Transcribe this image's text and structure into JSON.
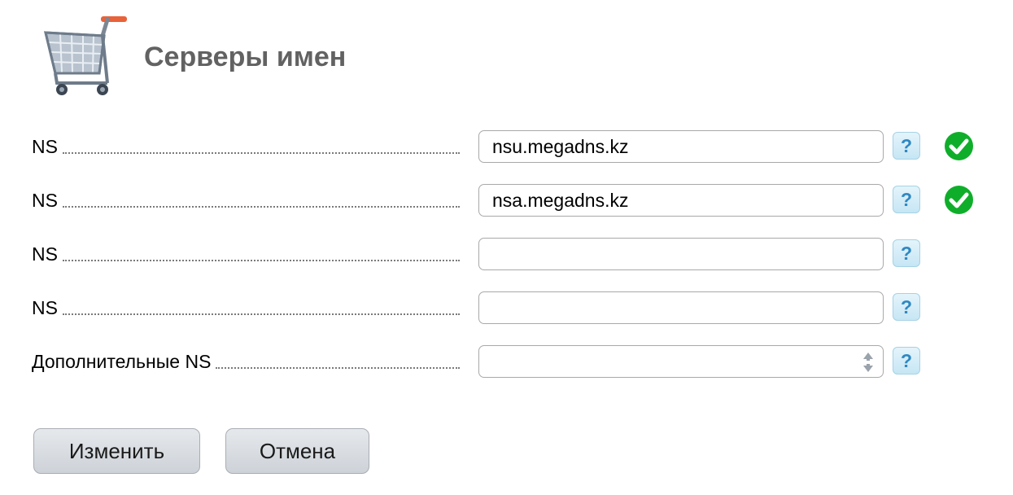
{
  "header": {
    "title": "Серверы имен",
    "logo_icon": "shopping-cart-icon"
  },
  "rows": [
    {
      "label": "NS",
      "value": "nsu.megadns.kz",
      "help": "?",
      "status": "valid"
    },
    {
      "label": "NS",
      "value": "nsa.megadns.kz",
      "help": "?",
      "status": "valid"
    },
    {
      "label": "NS",
      "value": "",
      "help": "?",
      "status": ""
    },
    {
      "label": "NS",
      "value": "",
      "help": "?",
      "status": ""
    },
    {
      "label": "Дополнительные NS",
      "value": "",
      "help": "?",
      "status": ""
    }
  ],
  "buttons": {
    "submit_label": "Изменить",
    "cancel_label": "Отмена"
  },
  "colors": {
    "title": "#626262",
    "help_icon": "#2f88c2",
    "status_ok": "#0fae2a",
    "button_bg": "#d4d8dd"
  }
}
